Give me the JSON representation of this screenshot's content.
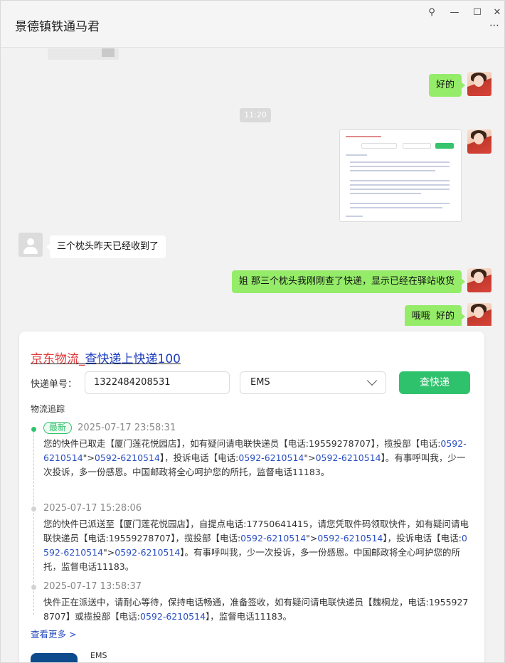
{
  "window": {
    "title": "景德镇铁通马君",
    "pin": "⚲",
    "minimize": "—",
    "maximize": "☐",
    "close": "✕",
    "more": "⋯"
  },
  "chat": {
    "messages": [
      {
        "side": "right",
        "text": "好的"
      },
      {
        "side": "time",
        "text": "11:20"
      },
      {
        "side": "left",
        "text": "三个枕头昨天已经收到了"
      },
      {
        "side": "right",
        "text": "姐 那三个枕头我刚刚查了快递，显示已经在驿站收货"
      },
      {
        "side": "right",
        "text": "哦哦  好的"
      }
    ]
  },
  "express": {
    "brand_part1": "京东物流_",
    "brand_part2": "查快递",
    "brand_part3": "上快递",
    "brand_part4": "100",
    "number_label": "快递单号：",
    "number_value": "1322484208531",
    "company": "EMS",
    "query_button": "查快递",
    "track_title": "物流追踪",
    "entries": [
      {
        "badge": "最新",
        "time": "2025-07-17 23:58:31",
        "parts": [
          {
            "t": "您的快件已取走【厦门莲花悦园店】，如有疑问请电联快递员【电话:19559278707】，揽投部【电话:",
            "ph": false
          },
          {
            "t": "0592-6210514",
            "ph": true
          },
          {
            "t": "\">",
            "ph": false
          },
          {
            "t": "0592-6210514",
            "ph": true
          },
          {
            "t": "】，投诉电话【电话:",
            "ph": false
          },
          {
            "t": "0592-6210514",
            "ph": true
          },
          {
            "t": "\">",
            "ph": false
          },
          {
            "t": "0592-6210514",
            "ph": true
          },
          {
            "t": "】。有事呼叫我，少一次投诉，多一份感恩。中国邮政将全心呵护您的所托，监督电话11183。",
            "ph": false
          }
        ]
      },
      {
        "badge": "",
        "time": "2025-07-17 15:28:06",
        "parts": [
          {
            "t": "您的快件已派送至【厦门莲花悦园店】，自提点电话:17750641415，请您凭取件码领取快件，如有疑问请电联快递员【电话:19559278707】，揽投部【电话:",
            "ph": false
          },
          {
            "t": "0592-6210514",
            "ph": true
          },
          {
            "t": "\">",
            "ph": false
          },
          {
            "t": "0592-6210514",
            "ph": true
          },
          {
            "t": "】，投诉电话【电话:",
            "ph": false
          },
          {
            "t": "0592-6210514",
            "ph": true
          },
          {
            "t": "\">",
            "ph": false
          },
          {
            "t": "0592-6210514",
            "ph": true
          },
          {
            "t": "】。有事呼叫我，少一次投诉，多一份感恩。中国邮政将全心呵护您的所托，监督电话11183。",
            "ph": false
          }
        ]
      },
      {
        "badge": "",
        "time": "2025-07-17 13:58:37",
        "parts": [
          {
            "t": "快件正在派送中，请耐心等待，保持电话畅通，准备签收，如有疑问请电联快递员【魏桐龙，电话:19559278707】或揽投部【电话:",
            "ph": false
          },
          {
            "t": "0592-6210514",
            "ph": true
          },
          {
            "t": "】，监督电话11183。",
            "ph": false
          }
        ]
      }
    ],
    "see_more": "查看更多 >",
    "next_label": "EMS"
  },
  "colors": {
    "green_bubble": "#95ec69",
    "query_green": "#2fc26c",
    "brand_red": "#e23b3b",
    "brand_blue": "#1f3fbf",
    "phone_blue": "#2a4fc1"
  }
}
